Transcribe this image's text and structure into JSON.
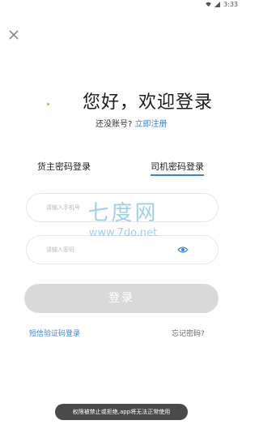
{
  "status": {
    "battery": "3:33"
  },
  "greeting": "您好，欢迎登录",
  "register": {
    "prompt": "还没账号?",
    "link": "立即注册"
  },
  "tabs": [
    {
      "label": "货主密码登录",
      "selected": false
    },
    {
      "label": "司机密码登录",
      "selected": true
    }
  ],
  "form": {
    "phone_placeholder": "请输入手机号",
    "password_placeholder": "请输入密码"
  },
  "login_label": "登录",
  "sms_login": "短信验证码登录",
  "forgot_password": "忘记密码?",
  "watermark": {
    "title": "七度网",
    "url": "www.7do.net"
  },
  "toast": "权限被禁止或拒绝,app将无法正常使用",
  "colors": {
    "accent": "#3b82d6",
    "button_disabled": "#d9d9d9",
    "toast_bg": "#4a4a4a"
  }
}
